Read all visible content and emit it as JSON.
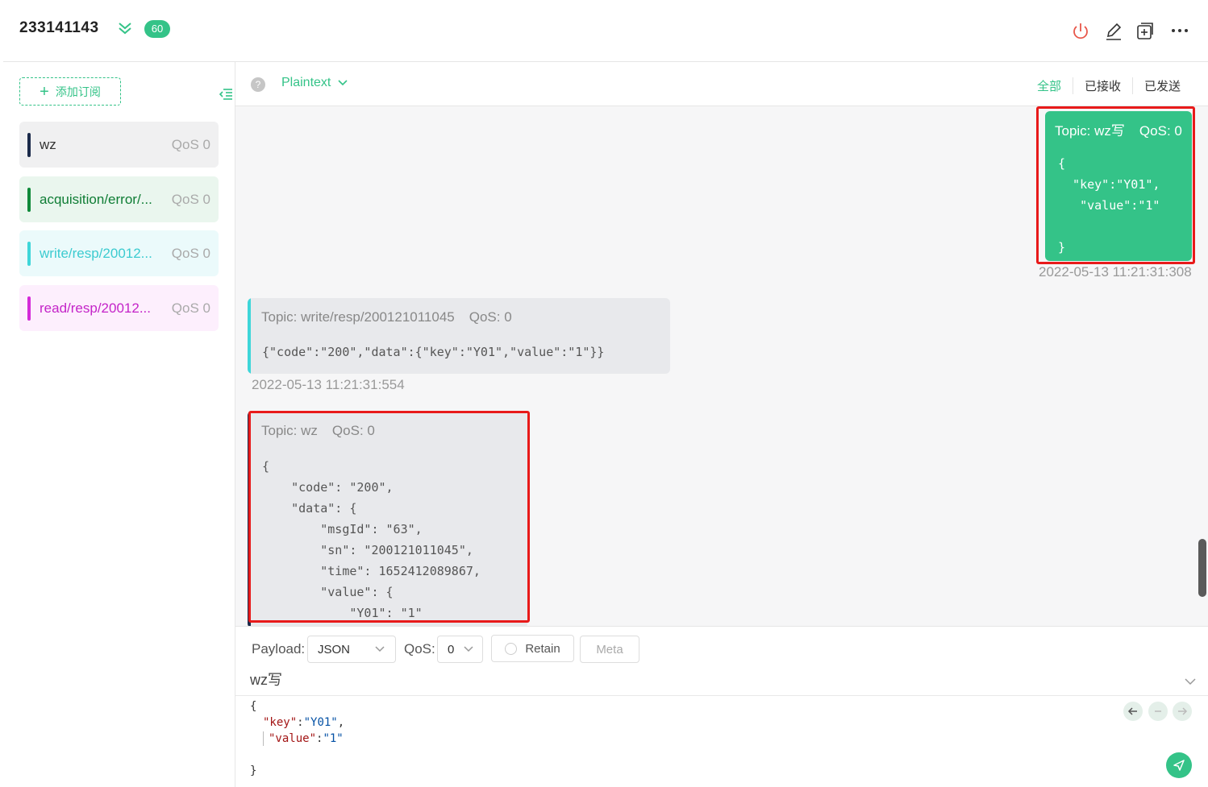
{
  "header": {
    "connection_name": "233141143",
    "badge_count": "60"
  },
  "sidebar": {
    "add_subscription_label": "添加订阅",
    "subscriptions": [
      {
        "topic": "wz",
        "qos": "QoS 0",
        "color": "#1b2a4a",
        "bg": "#f0f0f1",
        "text_color": "#333333"
      },
      {
        "topic": "acquisition/error/...",
        "qos": "QoS 0",
        "color": "#0f8a3a",
        "bg": "#eaf6ee",
        "text_color": "#0f7d35"
      },
      {
        "topic": "write/resp/20012...",
        "qos": "QoS 0",
        "color": "#3ed6d9",
        "bg": "#ebfafb",
        "text_color": "#3ccbd0"
      },
      {
        "topic": "read/resp/20012...",
        "qos": "QoS 0",
        "color": "#d42ad8",
        "bg": "#fdeffd",
        "text_color": "#c424c8"
      }
    ]
  },
  "message_header": {
    "help": "?",
    "format": "Plaintext",
    "filters": [
      "全部",
      "已接收",
      "已发送"
    ]
  },
  "messages": {
    "sent": {
      "topic": "Topic: wz写",
      "qos": "QoS: 0",
      "payload": "{\n  \"key\":\"Y01\",\n   \"value\":\"1\"\n\n}",
      "time": "2022-05-13 11:21:31:308"
    },
    "received_1": {
      "topic": "Topic: write/resp/200121011045",
      "qos": "QoS: 0",
      "payload": "{\"code\":\"200\",\"data\":{\"key\":\"Y01\",\"value\":\"1\"}}",
      "time": "2022-05-13 11:21:31:554",
      "color": "#3ed6d9"
    },
    "received_2": {
      "topic": "Topic: wz",
      "qos": "QoS: 0",
      "payload": "{\n    \"code\": \"200\",\n    \"data\": {\n        \"msgId\": \"63\",\n        \"sn\": \"200121011045\",\n        \"time\": 1652412089867,\n        \"value\": {\n            \"Y01\": \"1\"",
      "color": "#1b2a4a"
    }
  },
  "composer": {
    "payload_label": "Payload:",
    "payload_format": "JSON",
    "qos_label": "QoS:",
    "qos_value": "0",
    "retain_label": "Retain",
    "meta_label": "Meta",
    "topic": "wz写",
    "editor_lines": {
      "open": "{",
      "key_k": "\"key\"",
      "key_v": "\"Y01\"",
      "value_k": "\"value\"",
      "value_v": "\"1\"",
      "close": "}"
    }
  },
  "colors": {
    "accent": "#34c388",
    "highlight": "#e81a1a"
  }
}
